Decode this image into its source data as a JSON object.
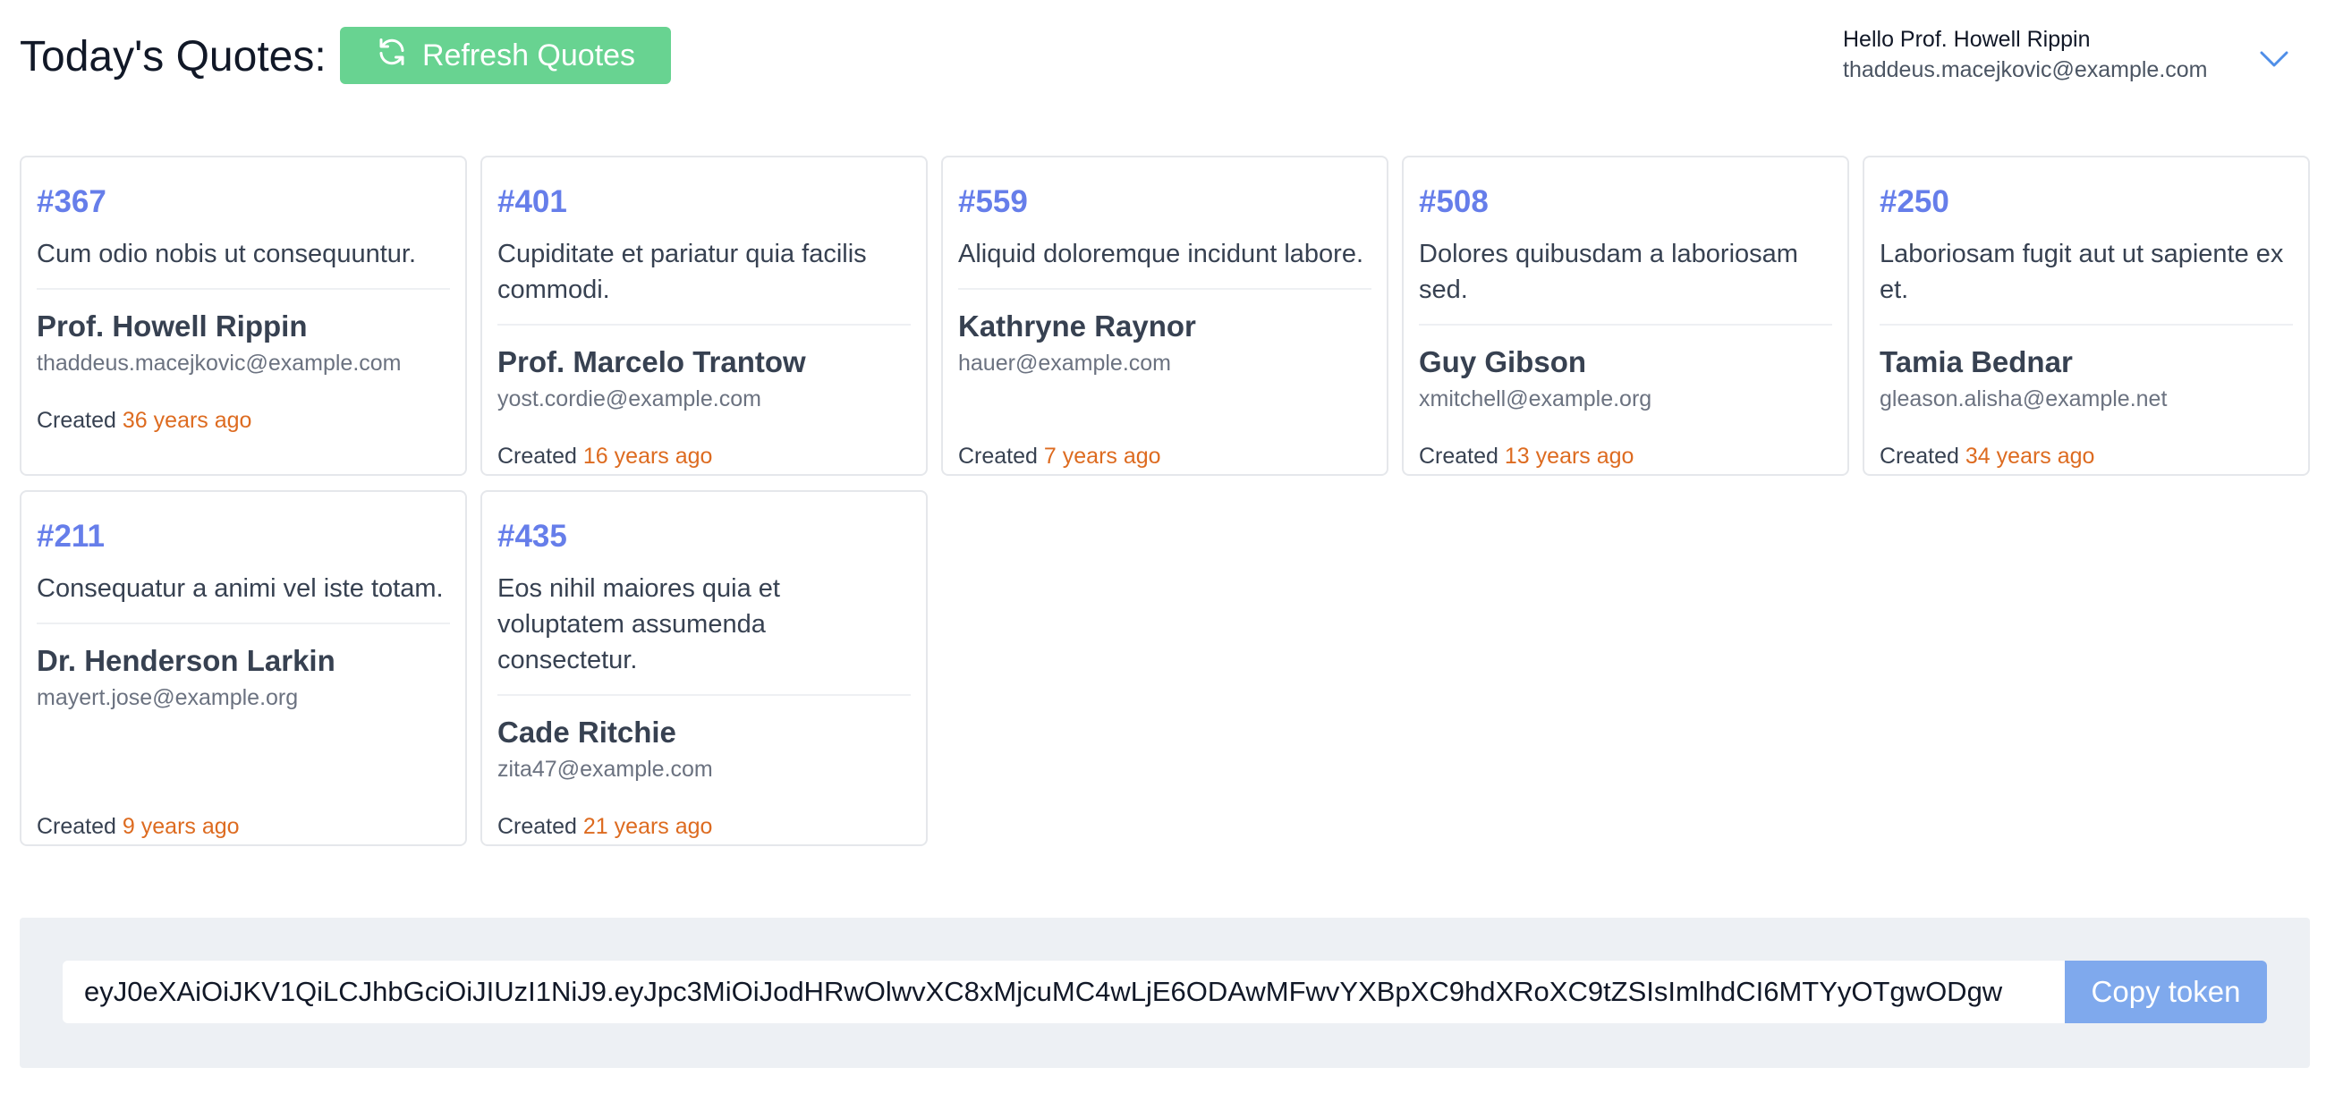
{
  "header": {
    "title": "Today's Quotes:",
    "refresh_label": "Refresh Quotes",
    "refresh_color": "#68d391"
  },
  "user": {
    "greeting": "Hello Prof. Howell Rippin",
    "email": "thaddeus.macejkovic@example.com"
  },
  "created_prefix": "Created",
  "quotes": [
    {
      "id": "#367",
      "text": "Cum odio nobis ut consequuntur.",
      "author": "Prof. Howell Rippin",
      "email": "thaddeus.macejkovic@example.com",
      "ago": "36 years ago"
    },
    {
      "id": "#401",
      "text": "Cupiditate et pariatur quia facilis commodi.",
      "author": "Prof. Marcelo Trantow",
      "email": "yost.cordie@example.com",
      "ago": "16 years ago"
    },
    {
      "id": "#559",
      "text": "Aliquid doloremque incidunt labore.",
      "author": "Kathryne Raynor",
      "email": "hauer@example.com",
      "ago": "7 years ago"
    },
    {
      "id": "#508",
      "text": "Dolores quibusdam a laboriosam sed.",
      "author": "Guy Gibson",
      "email": "xmitchell@example.org",
      "ago": "13 years ago"
    },
    {
      "id": "#250",
      "text": "Laboriosam fugit aut ut sapiente ex et.",
      "author": "Tamia Bednar",
      "email": "gleason.alisha@example.net",
      "ago": "34 years ago"
    },
    {
      "id": "#211",
      "text": "Consequatur a animi vel iste totam.",
      "author": "Dr. Henderson Larkin",
      "email": "mayert.jose@example.org",
      "ago": "9 years ago"
    },
    {
      "id": "#435",
      "text": "Eos nihil maiores quia et voluptatem assumenda consectetur.",
      "author": "Cade Ritchie",
      "email": "zita47@example.com",
      "ago": "21 years ago"
    }
  ],
  "token": {
    "value": "eyJ0eXAiOiJKV1QiLCJhbGciOiJIUzI1NiJ9.eyJpc3MiOiJodHRwOlwvXC8xMjcuMC4wLjE6ODAwMFwvYXBpXC9hdXRoXC9tZSIsImlhdCI6MTYyOTgwODgw",
    "copy_label": "Copy token",
    "copy_color": "#7fa9ed"
  },
  "accent_colors": {
    "quote_id": "#667eea",
    "time_ago": "#dd6b20"
  }
}
